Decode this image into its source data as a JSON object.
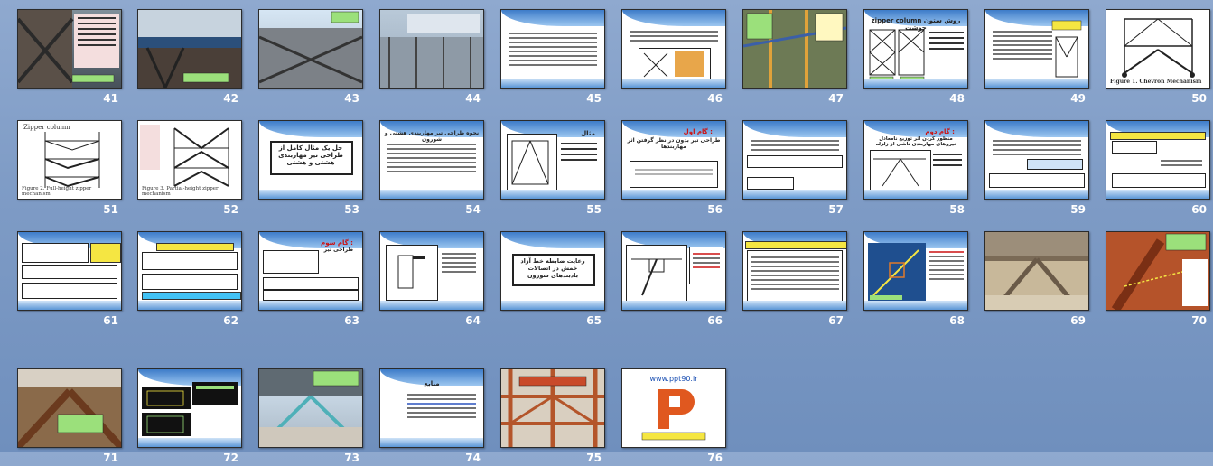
{
  "slides": [
    {
      "number": "41"
    },
    {
      "number": "42"
    },
    {
      "number": "43"
    },
    {
      "number": "44"
    },
    {
      "number": "45"
    },
    {
      "number": "46"
    },
    {
      "number": "47"
    },
    {
      "number": "48"
    },
    {
      "number": "49"
    },
    {
      "number": "50"
    },
    {
      "number": "51"
    },
    {
      "number": "52"
    },
    {
      "number": "53"
    },
    {
      "number": "54"
    },
    {
      "number": "55"
    },
    {
      "number": "56"
    },
    {
      "number": "57"
    },
    {
      "number": "58"
    },
    {
      "number": "59"
    },
    {
      "number": "60"
    },
    {
      "number": "61"
    },
    {
      "number": "62"
    },
    {
      "number": "63"
    },
    {
      "number": "64"
    },
    {
      "number": "65"
    },
    {
      "number": "66"
    },
    {
      "number": "67"
    },
    {
      "number": "68"
    },
    {
      "number": "69"
    },
    {
      "number": "70"
    },
    {
      "number": "71"
    },
    {
      "number": "72"
    },
    {
      "number": "73"
    },
    {
      "number": "74"
    },
    {
      "number": "75"
    },
    {
      "number": "76"
    }
  ],
  "slide_text": {
    "s48_title": "zipper column روش ستون جوشت",
    "s50_caption": "Figure 1. Chevron Mechanism",
    "s51_title": "Zipper column",
    "s51_caption": "Figure 2. Full-height zipper mechanism",
    "s52_caption": "Figure 3. Partial-height zipper mechanism",
    "s53_title": "حل یک مثال کامل از طراحی تیر مهاربندی هشتی و هشتی",
    "s54_title": "نحوه طراحی تیر مهاربندی هشتی و شورون",
    "s55_title": "مثال",
    "s56_title": "گام اول :",
    "s56_subtitle": "طراحی تیر بدون در نظر گرفتن اثر مهاربندها",
    "s58_title": "گام دوم :",
    "s58_subtitle": "منظور کردن اثر توزیع نامعادل نیروهای مهاربندی ناشی از زلزله",
    "s63_title": "گام سوم :",
    "s63_subtitle": "طراحی تیر",
    "s65_title": "رعایت ضابطه خط آزاد خمش در اتصالات بادبندهای شورون",
    "s74_title": "منابع",
    "s76_url": "www.ppt90.ir"
  },
  "colors": {
    "background": "#7f9cc6",
    "slide_number": "#ffffff",
    "accent_red": "#c11111",
    "accent_yellow": "#f5e642",
    "accent_green": "#9be07b"
  }
}
